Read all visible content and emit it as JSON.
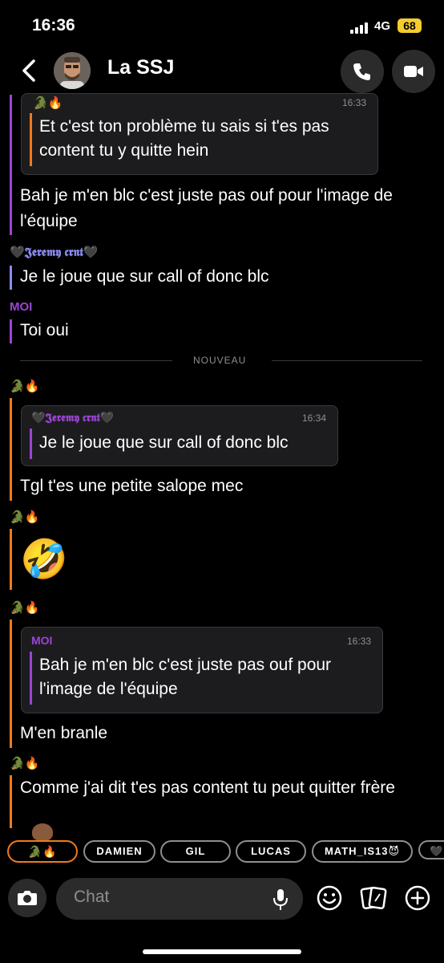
{
  "status_bar": {
    "time": "16:36",
    "network": "4G",
    "battery": "68"
  },
  "header": {
    "title": "La SSJ"
  },
  "senders": {
    "dragon": "🐊🔥",
    "jeremy": "🖤𝕵𝖊𝖗𝖊𝖒𝖞 𝖈𝖗𝖓𝖙🖤",
    "moi": "MOI"
  },
  "messages": {
    "m1_quote_text": "Et c'est ton problème tu sais si t'es pas content tu y quitte hein",
    "m1_quote_time": "16:33",
    "m1_text": "Bah je m'en blc c'est juste pas ouf pour l'image de l'équipe",
    "m2_text": "Je le joue que sur call of donc blc",
    "m3_text": "Toi oui",
    "divider": "NOUVEAU",
    "m4_quote_time": "16:34",
    "m4_quote_text": "Je le joue que sur call of donc blc",
    "m4_text": "Tgl t'es une petite salope mec",
    "m5_emoji": "🤣",
    "m6_quote_time": "16:33",
    "m6_quote_text": "Bah je m'en blc c'est juste pas ouf pour l'image de l'équipe",
    "m6_text": "M'en branle",
    "m7_text": "Comme j'ai dit t'es pas content tu peut quitter frère"
  },
  "mention_chips": [
    "🐊🔥",
    "DAMIEN",
    "GIL",
    "LUCAS",
    "MATH_IS13😈",
    "🖤"
  ],
  "input": {
    "placeholder": "Chat"
  },
  "colors": {
    "dragon": "#f07a1a",
    "jeremy": "#8c8cf0",
    "moi": "#9b45d4",
    "accent": "#f3cc2e"
  }
}
